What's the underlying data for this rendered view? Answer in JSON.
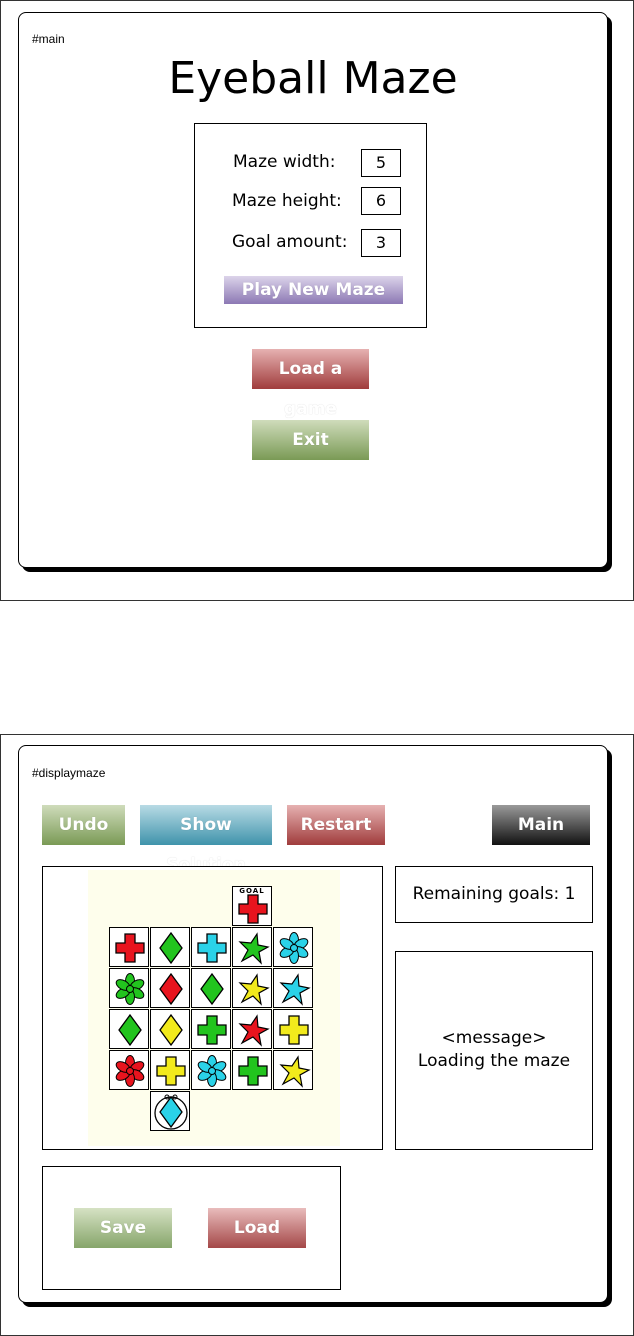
{
  "main_screen": {
    "tag": "#main",
    "title": "Eyeball Maze",
    "form": {
      "width_label": "Maze width:",
      "width_value": "5",
      "height_label": "Maze height:",
      "height_value": "6",
      "goal_label": "Goal amount:",
      "goal_value": "3",
      "play_button": "Play New Maze"
    },
    "load_button": "Load a game",
    "exit_button": "Exit"
  },
  "maze_screen": {
    "tag": "#displaymaze",
    "toolbar": {
      "undo": "Undo",
      "show_solution": "Show Solution",
      "restart": "Restart",
      "main": "Main"
    },
    "goal_label": "GOAL",
    "remaining_goals": "Remaining goals: 1",
    "message_line1": "<message>",
    "message_line2": "Loading the maze",
    "save_button": "Save",
    "load_button": "Load",
    "colors": {
      "red": "#e8141e",
      "green": "#22c41e",
      "cyan": "#2ad2e8",
      "yellow": "#f2ea1c"
    },
    "grid": [
      [
        {
          "color": "red",
          "shape": "cross"
        },
        {
          "color": "green",
          "shape": "diamond"
        },
        {
          "color": "cyan",
          "shape": "cross"
        },
        {
          "color": "green",
          "shape": "star"
        },
        {
          "color": "cyan",
          "shape": "flower"
        }
      ],
      [
        {
          "color": "green",
          "shape": "flower"
        },
        {
          "color": "red",
          "shape": "diamond"
        },
        {
          "color": "green",
          "shape": "diamond"
        },
        {
          "color": "yellow",
          "shape": "star"
        },
        {
          "color": "cyan",
          "shape": "star"
        }
      ],
      [
        {
          "color": "green",
          "shape": "diamond"
        },
        {
          "color": "yellow",
          "shape": "diamond"
        },
        {
          "color": "green",
          "shape": "cross"
        },
        {
          "color": "red",
          "shape": "star"
        },
        {
          "color": "yellow",
          "shape": "cross"
        }
      ],
      [
        {
          "color": "red",
          "shape": "flower"
        },
        {
          "color": "yellow",
          "shape": "cross"
        },
        {
          "color": "cyan",
          "shape": "flower"
        },
        {
          "color": "green",
          "shape": "cross"
        },
        {
          "color": "yellow",
          "shape": "star"
        }
      ]
    ],
    "goal_cell": {
      "color": "red",
      "shape": "cross"
    },
    "eyeball_cell": {
      "color": "cyan",
      "shape": "diamond"
    }
  }
}
